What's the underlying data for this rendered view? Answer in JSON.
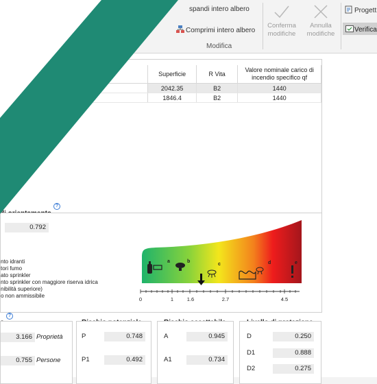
{
  "ribbon": {
    "expand_label": "spandi intero albero",
    "collapse_label": "Comprimi intero albero",
    "confirm_label": "Conferma modifiche",
    "cancel_label": "Annulla modifiche",
    "group_label": "Modifica",
    "project_label": "Progett",
    "verify_label": "Verifica"
  },
  "table": {
    "columns": [
      "Superficie",
      "R Vita",
      "Valore nominale carico di incendio specifico qf"
    ],
    "rows": [
      {
        "superficie": "2042.35",
        "rvita": "B2",
        "qf": "1440"
      },
      {
        "superficie": "1846.4",
        "rvita": "B2",
        "qf": "1440"
      }
    ]
  },
  "orientamento": {
    "title": "di orientamento",
    "value": "0.792",
    "legend": [
      "nto idranti",
      "tori fumo",
      "ato sprinkler",
      "nto sprinkler con maggiore riserva idrica",
      "nibilità superiore)",
      "o non ammissibile"
    ],
    "scale_ticks": [
      "0",
      "1",
      "1.6",
      "2.7",
      "4.5"
    ],
    "markers": [
      "a",
      "b",
      "c",
      "d",
      "e"
    ]
  },
  "left_block": {
    "title": "o",
    "row1_value": "3.166",
    "row1_label": "Proprietà",
    "row2_value": "0.755",
    "row2_label": "Persone"
  },
  "rischio_potenziale": {
    "title": "Rischio potenziale",
    "rows": [
      {
        "label": "P",
        "value": "0.748"
      },
      {
        "label": "P1",
        "value": "0.492"
      }
    ]
  },
  "rischio_accettabile": {
    "title": "Rischio accettabile",
    "rows": [
      {
        "label": "A",
        "value": "0.945"
      },
      {
        "label": "A1",
        "value": "0.734"
      }
    ]
  },
  "livello_protezione": {
    "title": "Livello di protezione",
    "rows": [
      {
        "label": "D",
        "value": "0.250"
      },
      {
        "label": "D1",
        "value": "0.888"
      },
      {
        "label": "D2",
        "value": "0.275"
      }
    ]
  },
  "colors": {
    "teal_decoration": "#1f8a74",
    "grad_green": "#1fb36b",
    "grad_yellow": "#f3e61c",
    "grad_red": "#ee1c1c",
    "grad_dark_red": "#a4161c"
  }
}
